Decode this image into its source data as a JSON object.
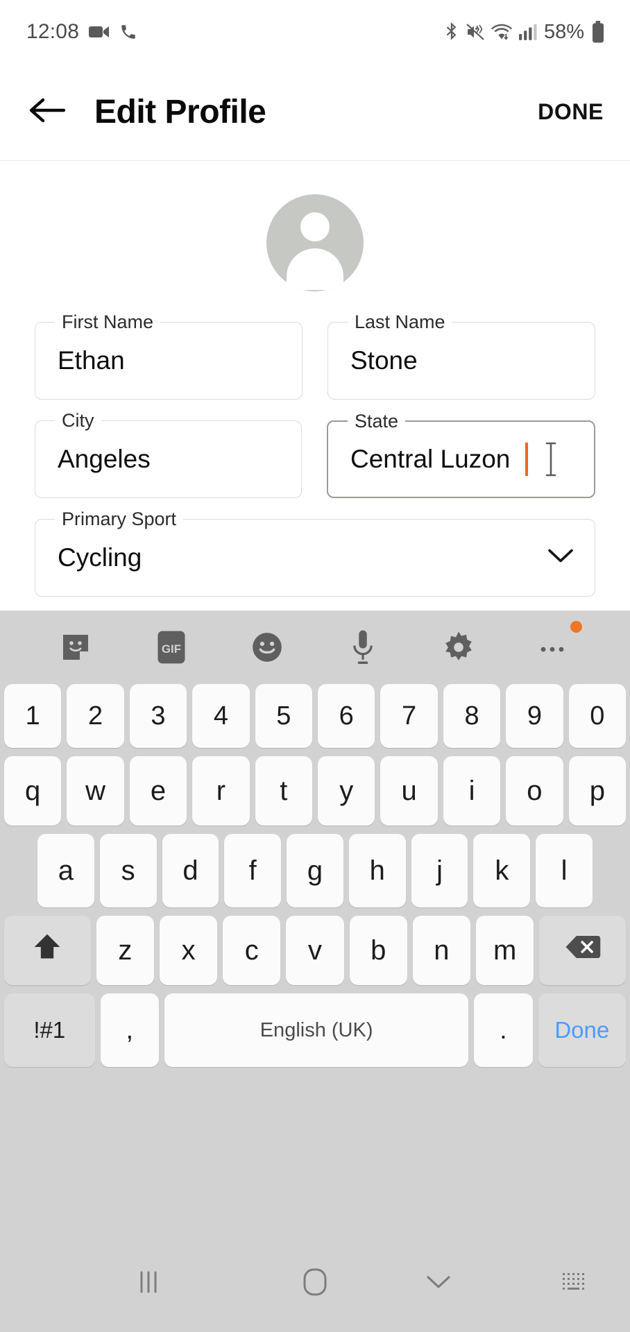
{
  "status_bar": {
    "time": "12:08",
    "battery_percent": "58%",
    "left_icons": [
      "video-camera-icon",
      "phone-call-icon"
    ],
    "right_icons": [
      "bluetooth-icon",
      "vibrate-mute-icon",
      "wifi-icon",
      "cellular-signal-icon",
      "battery-icon"
    ]
  },
  "app_bar": {
    "back_icon": "back-arrow-icon",
    "title": "Edit Profile",
    "done_label": "DONE"
  },
  "profile": {
    "avatar_icon": "person-avatar-icon",
    "avatar_color": "#c6c8c4"
  },
  "form": {
    "fields": [
      {
        "label": "First Name",
        "value": "Ethan",
        "focused": false
      },
      {
        "label": "Last Name",
        "value": "Stone",
        "focused": false
      },
      {
        "label": "City",
        "value": "Angeles",
        "focused": false
      },
      {
        "label": "State",
        "value": "Central Luzon",
        "focused": true,
        "caret_color": "#e8662a"
      }
    ],
    "dropdown": {
      "label": "Primary Sport",
      "value": "Cycling",
      "chevron_icon": "chevron-down-icon"
    }
  },
  "keyboard": {
    "toolbar_icons": [
      "sticker-icon",
      "gif-icon",
      "emoji-icon",
      "microphone-icon",
      "settings-gear-icon",
      "more-options-icon"
    ],
    "gif_label": "GIF",
    "badge_color": "#ef7622",
    "row_numbers": [
      "1",
      "2",
      "3",
      "4",
      "5",
      "6",
      "7",
      "8",
      "9",
      "0"
    ],
    "row_qwerty": [
      "q",
      "w",
      "e",
      "r",
      "t",
      "y",
      "u",
      "i",
      "o",
      "p"
    ],
    "row_asdf": [
      "a",
      "s",
      "d",
      "f",
      "g",
      "h",
      "j",
      "k",
      "l"
    ],
    "row_zxcv": [
      "z",
      "x",
      "c",
      "v",
      "b",
      "n",
      "m"
    ],
    "shift_icon": "shift-arrow-icon",
    "backspace_icon": "backspace-icon",
    "symbols_label": "!#1",
    "comma_label": ",",
    "space_label": "English (UK)",
    "period_label": ".",
    "done_label": "Done",
    "done_color": "#4c9aff"
  },
  "nav_bar": {
    "recents_icon": "recents-icon",
    "home_icon": "home-icon",
    "hide_keyboard_icon": "chevron-down-icon",
    "keyboard_switch_icon": "keyboard-switch-icon"
  }
}
